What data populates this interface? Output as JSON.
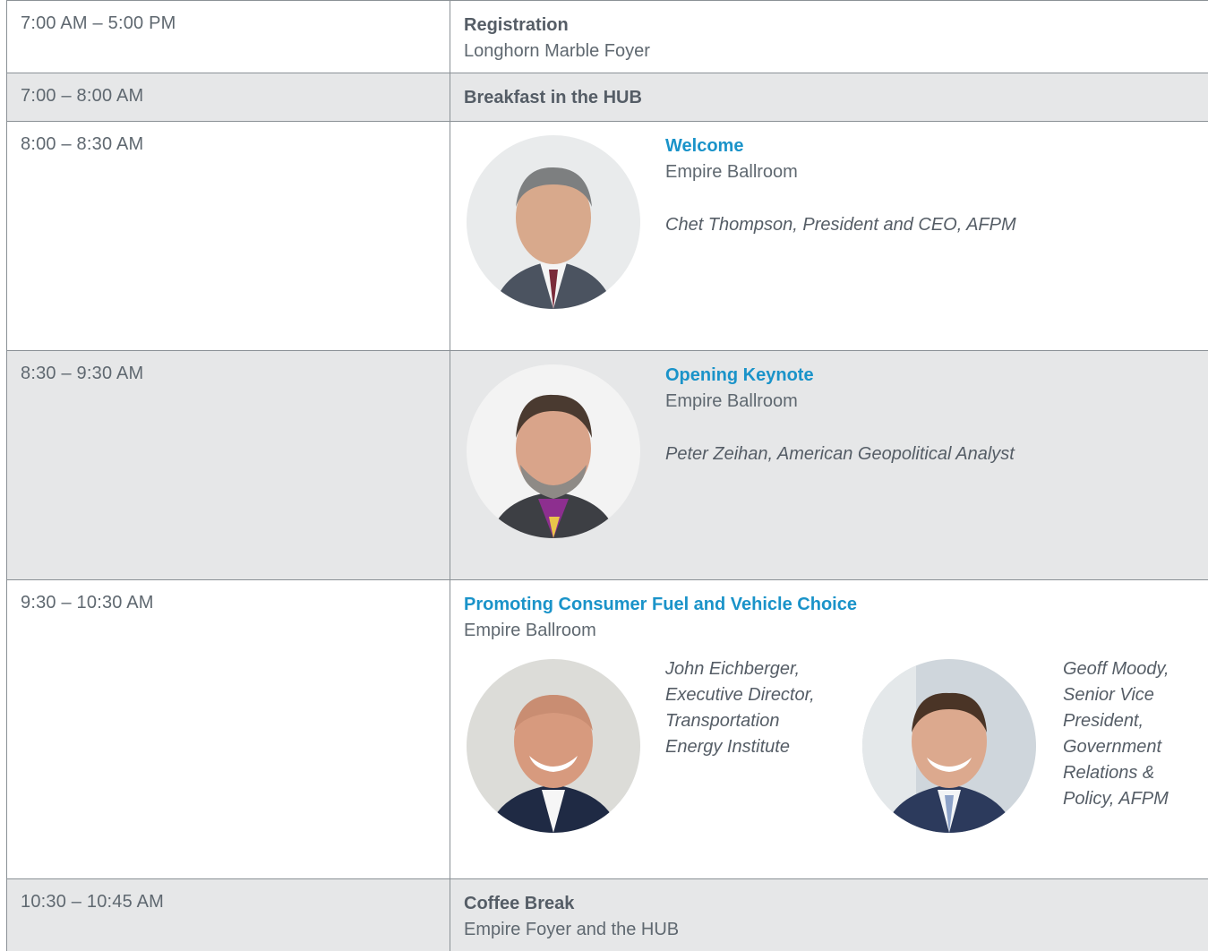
{
  "sessions": [
    {
      "time": "7:00 AM – 5:00 PM",
      "title": "Registration",
      "location": "Longhorn Marble Foyer"
    },
    {
      "time": "7:00 – 8:00 AM",
      "title": "Breakfast in the HUB"
    },
    {
      "time": "8:00 – 8:30 AM",
      "title": "Welcome",
      "location": "Empire Ballroom",
      "speaker": "Chet Thompson, President and CEO, AFPM",
      "photo_icon": "speaker-photo"
    },
    {
      "time": "8:30 – 9:30 AM",
      "title": "Opening Keynote",
      "location": "Empire Ballroom",
      "speaker": "Peter Zeihan, American Geopolitical Analyst",
      "photo_icon": "speaker-photo"
    },
    {
      "time": "9:30 – 10:30 AM",
      "title": "Promoting Consumer Fuel and Vehicle Choice",
      "location": "Empire Ballroom",
      "speakers": [
        {
          "lines": [
            "John Eichberger,",
            "Executive Director,",
            "Transportation",
            "Energy Institute"
          ]
        },
        {
          "lines": [
            "Geoff Moody,",
            "Senior Vice",
            "President,",
            "Government",
            "Relations &",
            "Policy, AFPM"
          ]
        }
      ]
    },
    {
      "time": "10:30 – 10:45 AM",
      "title": "Coffee Break",
      "location": "Empire Foyer and the HUB"
    }
  ],
  "colors": {
    "accent": "#1a93c9",
    "shade": "#e6e7e8",
    "border": "#8b9196",
    "text": "#555d66"
  }
}
